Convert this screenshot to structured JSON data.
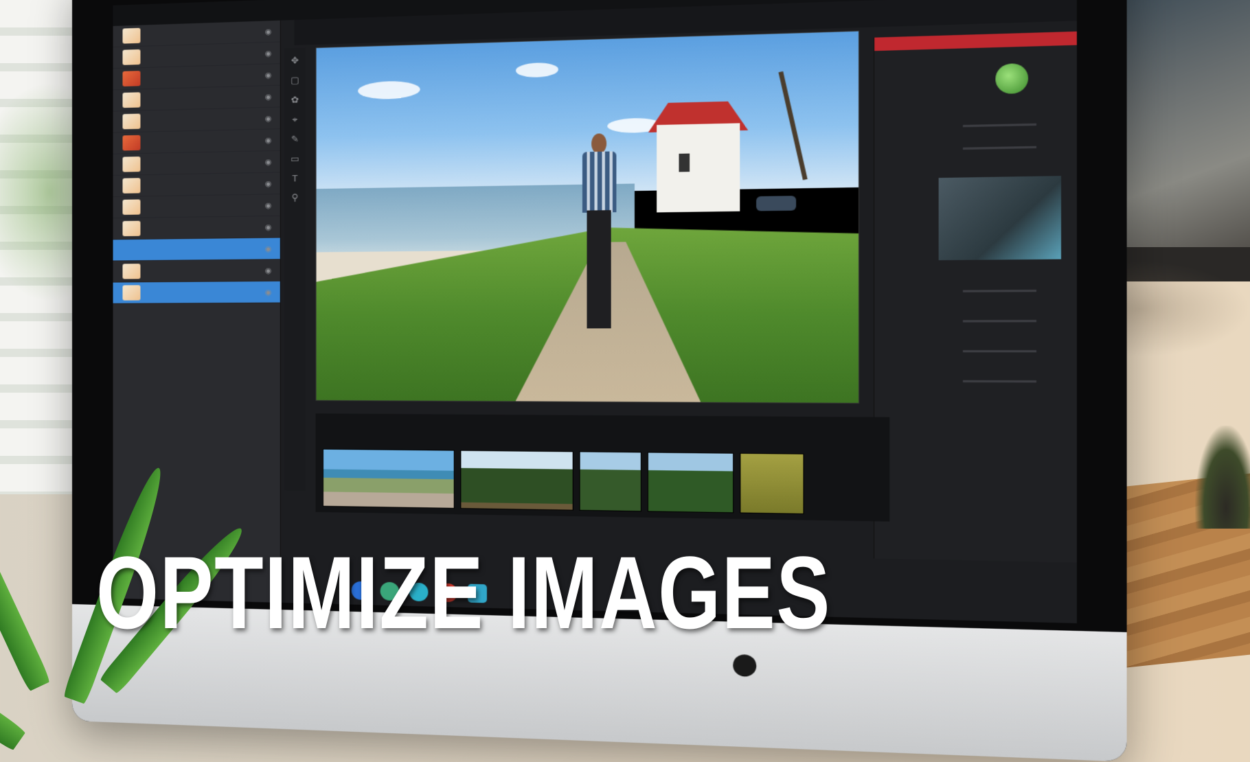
{
  "headline": "OPTIMIZE IMAGES",
  "colors": {
    "headline": "#ffffff",
    "accent_panel": "#c0282f",
    "selection": "#3a87d6"
  },
  "icons": [
    "apple-logo-icon"
  ]
}
